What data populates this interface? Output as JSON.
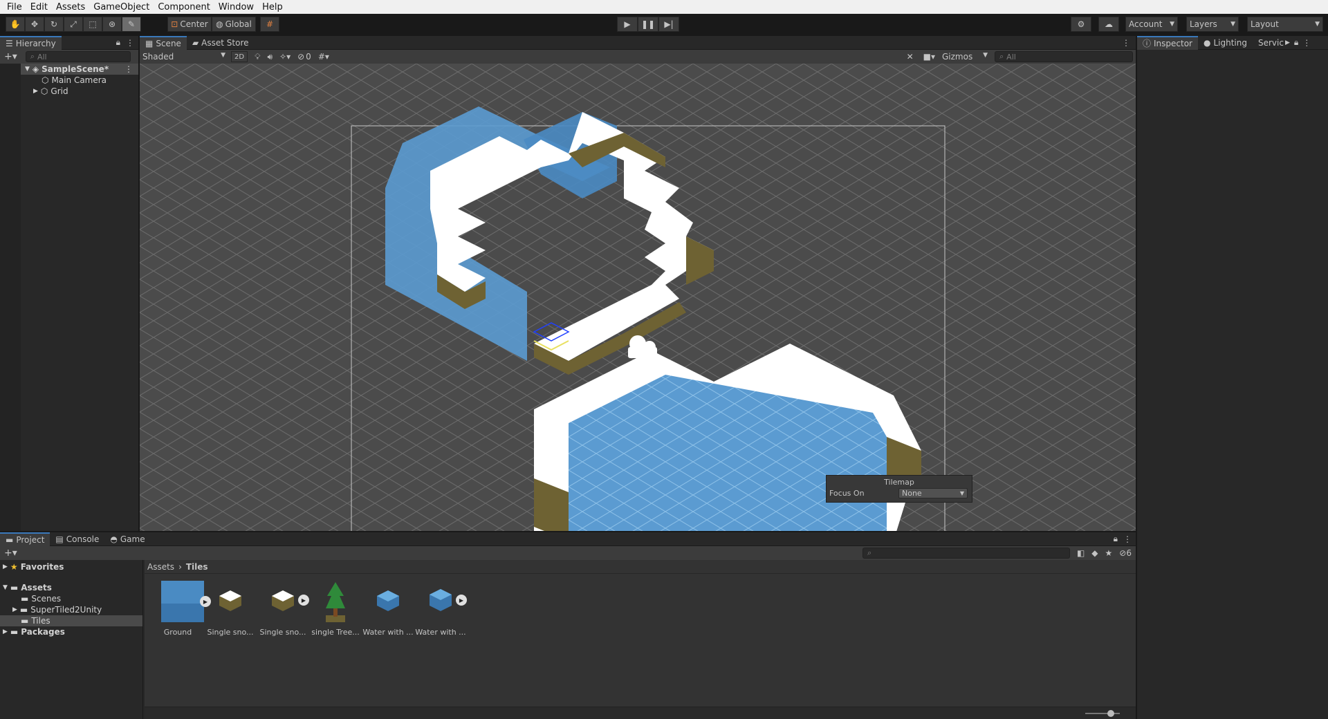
{
  "menu": [
    "File",
    "Edit",
    "Assets",
    "GameObject",
    "Component",
    "Window",
    "Help"
  ],
  "toolbar": {
    "center_label": "Center",
    "global_label": "Global",
    "account_label": "Account",
    "layers_label": "Layers",
    "layout_label": "Layout"
  },
  "hierarchy": {
    "tab": "Hierarchy",
    "search_placeholder": "All",
    "scene_name": "SampleScene*",
    "items": [
      "Main Camera",
      "Grid"
    ]
  },
  "scene": {
    "tabs": [
      "Scene",
      "Asset Store"
    ],
    "shading": "Shaded",
    "mode_2d": "2D",
    "hidden_count": "0",
    "gizmos_label": "Gizmos",
    "search_placeholder": "All"
  },
  "inspector": {
    "tabs": [
      "Inspector",
      "Lighting",
      "Servic"
    ]
  },
  "tilemap_overlay": {
    "title": "Tilemap",
    "focus_label": "Focus On",
    "focus_value": "None"
  },
  "bottom": {
    "tabs": [
      "Project",
      "Console",
      "Game"
    ],
    "hidden_count": "6",
    "favorites_label": "Favorites",
    "assets_label": "Assets",
    "folders": [
      "Scenes",
      "SuperTiled2Unity",
      "Tiles"
    ],
    "packages_label": "Packages",
    "breadcrumb": [
      "Assets",
      "Tiles"
    ],
    "assets": [
      "Ground",
      "Single sno...",
      "Single sno...",
      "single Tree...",
      "Water with ...",
      "Water with ..."
    ]
  },
  "colors": {
    "water": "#5b9bd1",
    "snow": "#ffffff",
    "dirt": "#6e6233",
    "scene_bg": "#4b4b4b",
    "accent": "#3a79bb"
  }
}
